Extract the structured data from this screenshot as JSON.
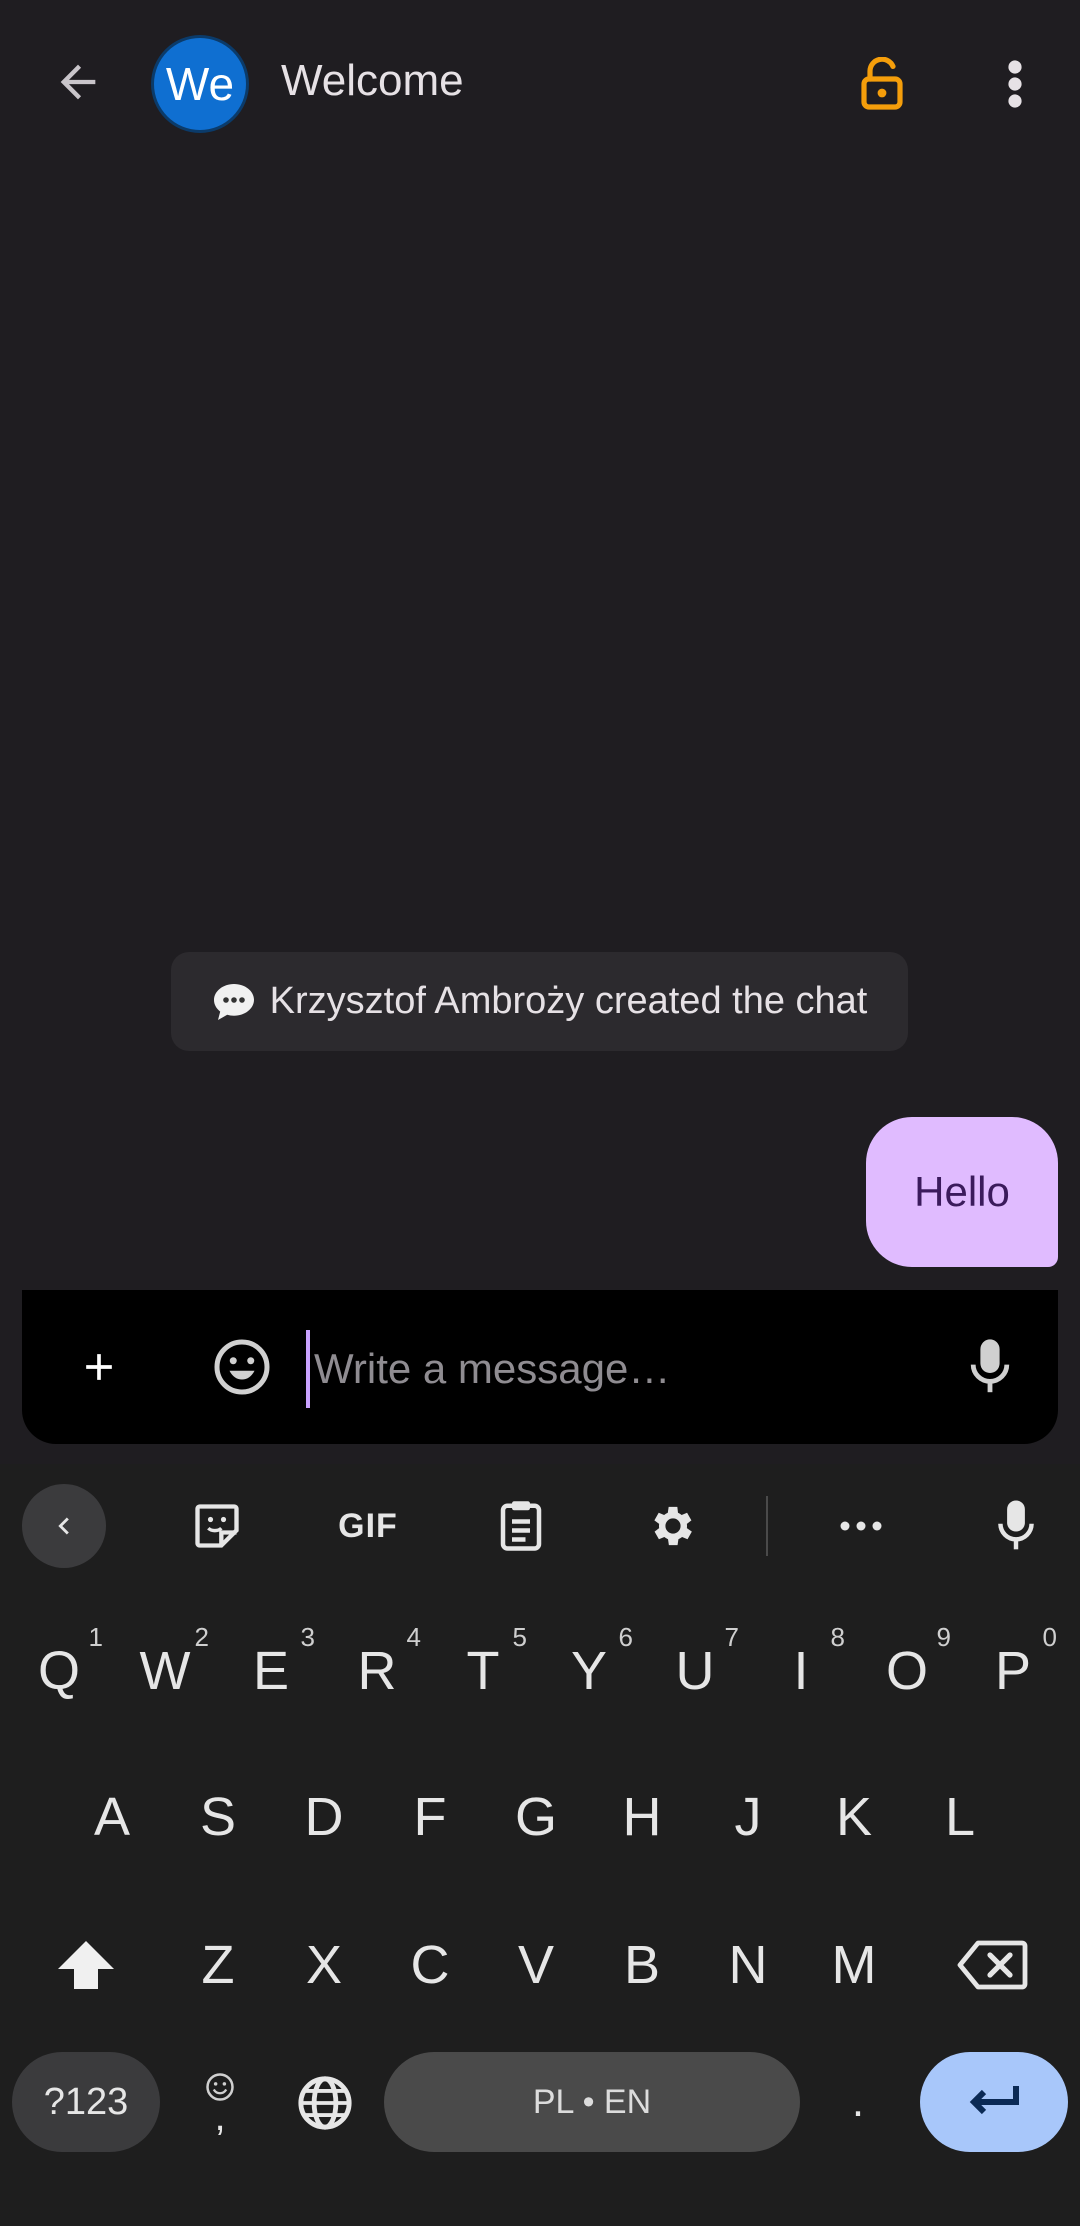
{
  "header": {
    "title": "Welcome",
    "avatar_text": "We",
    "lock_color": "#f59e0b"
  },
  "chat": {
    "system_message": "Krzysztof Ambroży created the chat",
    "messages": [
      {
        "text": "Hello",
        "direction": "outgoing"
      }
    ]
  },
  "composer": {
    "placeholder": "Write a message…"
  },
  "keyboard": {
    "row1": [
      {
        "key": "Q",
        "hint": "1"
      },
      {
        "key": "W",
        "hint": "2"
      },
      {
        "key": "E",
        "hint": "3"
      },
      {
        "key": "R",
        "hint": "4"
      },
      {
        "key": "T",
        "hint": "5"
      },
      {
        "key": "Y",
        "hint": "6"
      },
      {
        "key": "U",
        "hint": "7"
      },
      {
        "key": "I",
        "hint": "8"
      },
      {
        "key": "O",
        "hint": "9"
      },
      {
        "key": "P",
        "hint": "0"
      }
    ],
    "row2": [
      "A",
      "S",
      "D",
      "F",
      "G",
      "H",
      "J",
      "K",
      "L"
    ],
    "row3": [
      "Z",
      "X",
      "C",
      "V",
      "B",
      "N",
      "M"
    ],
    "symbols_label": "?123",
    "comma_label": ",",
    "space_label": "PL • EN",
    "period_label": ".",
    "gif_label": "GIF",
    "accent_color": "#a8c7fa"
  }
}
